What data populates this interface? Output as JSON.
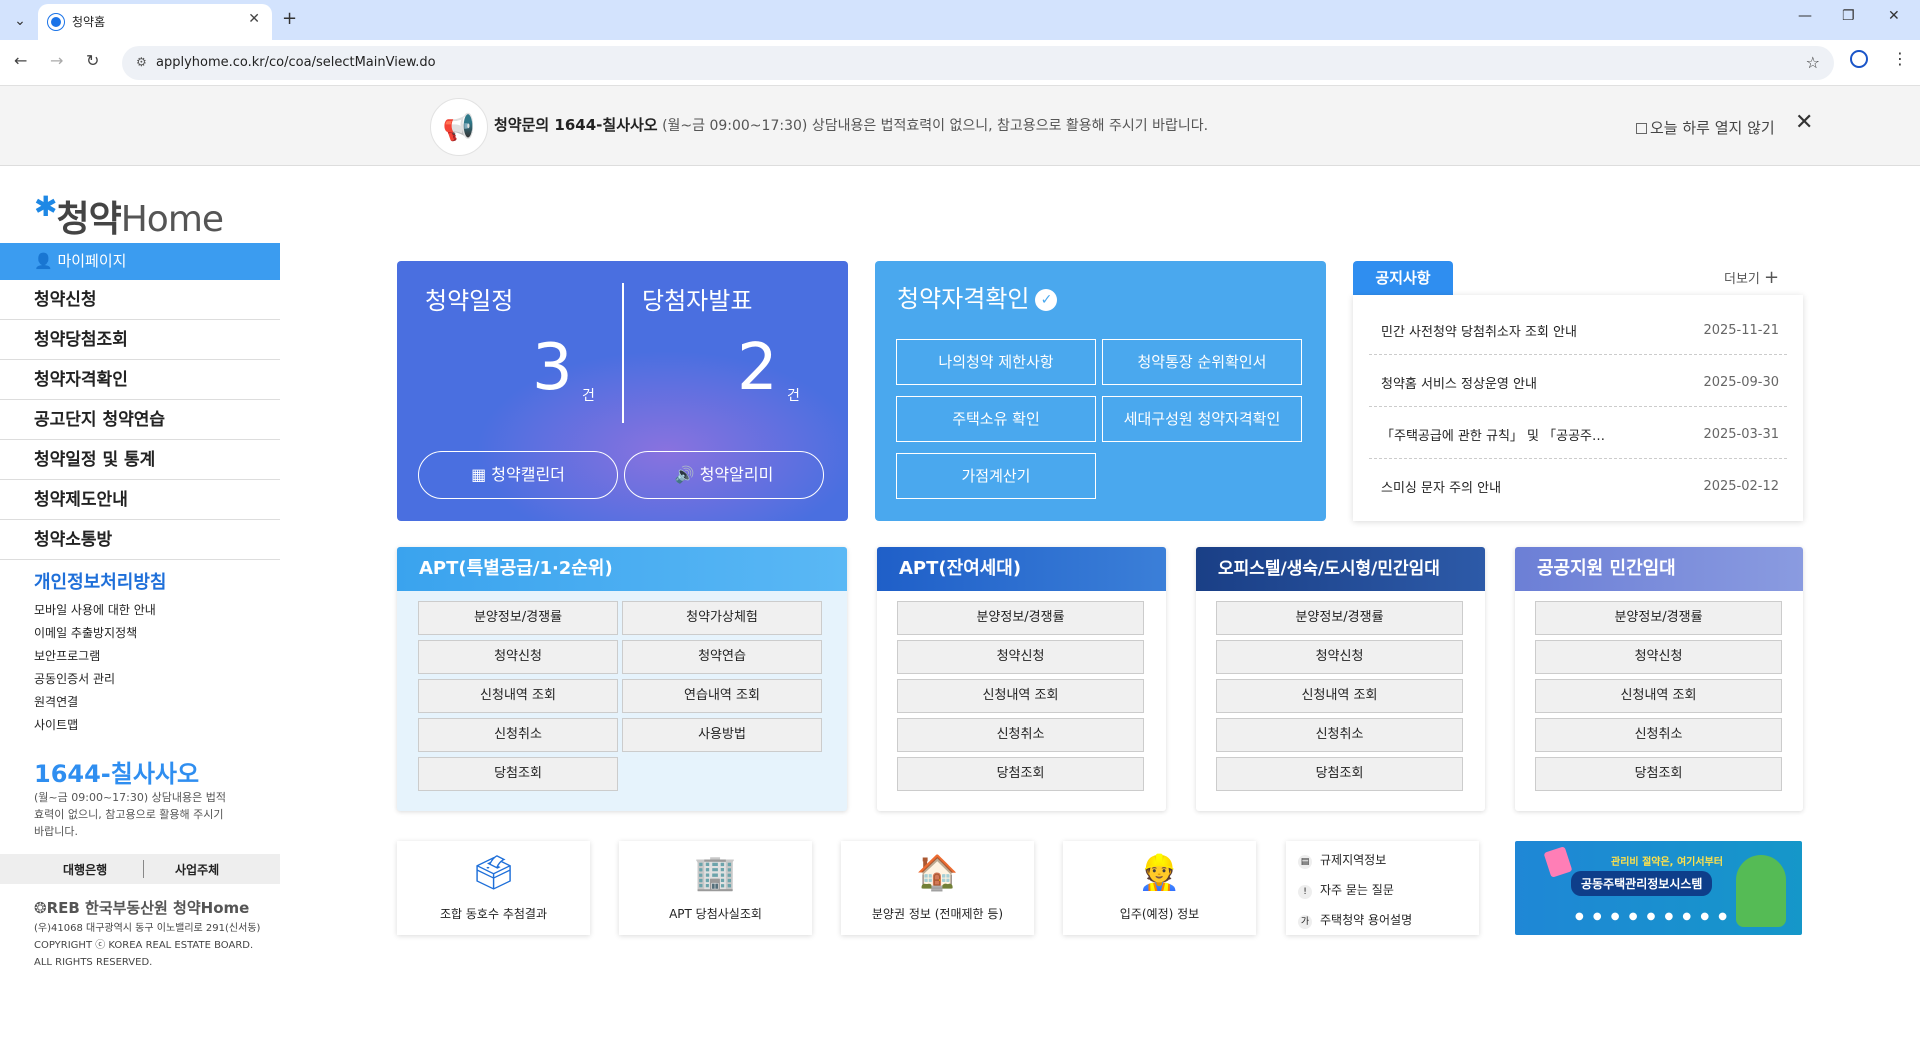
{
  "browser": {
    "tab_title": "청약홈",
    "url": "applyhome.co.kr/co/coa/selectMainView.do"
  },
  "banner": {
    "phone_label": "청약문의 1644-칠사사오",
    "hours": "(월~금 09:00~17:30)",
    "disclaimer": "상담내용은 법적효력이 없으니, 참고용으로 활용해 주시기 바랍니다.",
    "dont_show": "오늘 하루 열지 않기"
  },
  "logo": {
    "prefix": "청약",
    "suffix": "Home"
  },
  "sidebar": {
    "mypage": "마이페이지",
    "items": [
      "청약신청",
      "청약당첨조회",
      "청약자격확인",
      "공고단지 청약연습",
      "청약일정 및 통계",
      "청약제도안내",
      "청약소통방"
    ],
    "privacy": "개인정보처리방침",
    "links": [
      "모바일 사용에 대한 안내",
      "이메일 추출방지정책",
      "보안프로그램",
      "공동인증서 관리",
      "원격연결",
      "사이트맵"
    ],
    "phone": "1644-칠사사오",
    "note": "(월~금 09:00~17:30) 상담내용은 법적효력이 없으니, 참고용으로 활용해 주시기 바랍니다.",
    "bottom": {
      "left": "대행은행",
      "right": "사업주체"
    },
    "reb_logo": "한국부동산원 청약Home",
    "address": "(우)41068 대구광역시 동구 이노밸리로 291(신서동)",
    "copyright1": "COPYRIGHT ⓒ KOREA REAL ESTATE BOARD.",
    "copyright2": "ALL RIGHTS RESERVED."
  },
  "schedule_card": {
    "title1": "청약일정",
    "title2": "당첨자발표",
    "count1": "3",
    "count2": "2",
    "unit": "건",
    "btn1": "청약캘린더",
    "btn2": "청약알리미"
  },
  "qual_card": {
    "title": "청약자격확인",
    "buttons": [
      "나의청약 제한사항",
      "청약통장 순위확인서",
      "주택소유 확인",
      "세대구성원 청약자격확인",
      "가점계산기"
    ]
  },
  "notice": {
    "tab": "공지사항",
    "more": "더보기",
    "items": [
      {
        "title": "민간 사전청약 당첨취소자 조회 안내",
        "date": "2025-11-21"
      },
      {
        "title": "청약홈 서비스 정상운영 안내",
        "date": "2025-09-30"
      },
      {
        "title": "「주택공급에 관한 규칙」 및 「공공주…",
        "date": "2025-03-31"
      },
      {
        "title": "스미싱 문자 주의 안내",
        "date": "2025-02-12"
      }
    ]
  },
  "services": [
    {
      "title": "APT(특별공급/1·2순위)",
      "left": [
        "분양정보/경쟁률",
        "청약신청",
        "신청내역 조회",
        "신청취소",
        "당첨조회"
      ],
      "right": [
        "청약가상체험",
        "청약연습",
        "연습내역 조회",
        "사용방법"
      ]
    },
    {
      "title": "APT(잔여세대)",
      "items": [
        "분양정보/경쟁률",
        "청약신청",
        "신청내역 조회",
        "신청취소",
        "당첨조회"
      ]
    },
    {
      "title": "오피스텔/생숙/도시형/민간임대",
      "items": [
        "분양정보/경쟁률",
        "청약신청",
        "신청내역 조회",
        "신청취소",
        "당첨조회"
      ]
    },
    {
      "title": "공공지원 민간임대",
      "items": [
        "분양정보/경쟁률",
        "청약신청",
        "신청내역 조회",
        "신청취소",
        "당첨조회"
      ]
    }
  ],
  "quick_links": [
    "조합 동호수 추첨결과",
    "APT 당첨사실조회",
    "분양권 정보 (전매제한 등)",
    "입주(예정) 정보"
  ],
  "info_links": [
    "규제지역정보",
    "자주 묻는 질문",
    "주택청약 용어설명"
  ],
  "ad": {
    "top": "관리비 절약은, 여기서부터",
    "main": "공동주택관리정보시스템"
  },
  "colors": {
    "schedule": "#4a6fe0",
    "qual": "#4aa8ee",
    "accent": "#2f8ef0",
    "mypage": "#3b9cf0"
  }
}
